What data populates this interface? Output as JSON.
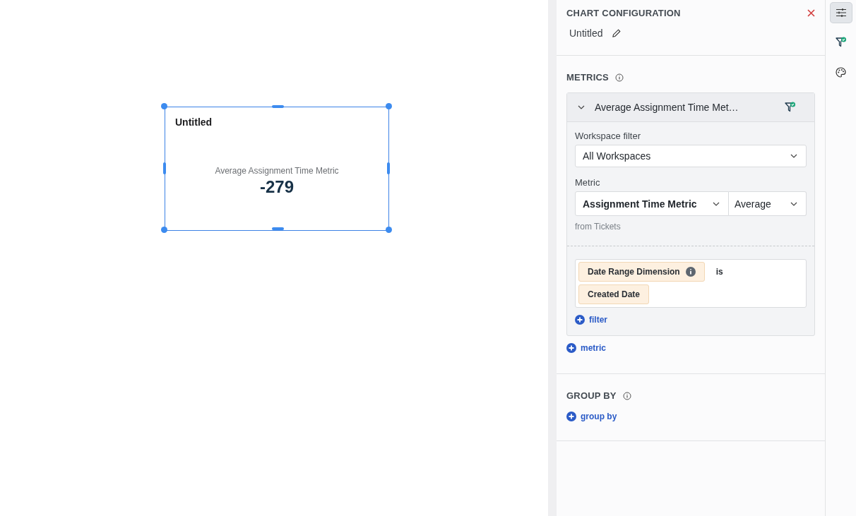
{
  "canvas": {
    "widget": {
      "title": "Untitled",
      "selected": true,
      "metric_label": "Average Assignment Time Metric",
      "value": "-279"
    }
  },
  "panel": {
    "title": "CHART CONFIGURATION",
    "chart_name": "Untitled",
    "metrics_heading": "METRICS",
    "metrics": [
      {
        "name": "Average Assignment Time Met…",
        "expanded": true,
        "workspace_filter_label": "Workspace filter",
        "workspace_filter": "All Workspaces",
        "metric_label": "Metric",
        "metric": "Assignment Time Metric",
        "aggregation": "Average",
        "source": "from Tickets",
        "filters": [
          {
            "dimension": "Date Range Dimension",
            "operator": "is",
            "value": "Created Date"
          }
        ],
        "add_filter": "filter"
      }
    ],
    "add_metric": "metric",
    "group_by_heading": "GROUP BY",
    "add_group_by": "group by"
  },
  "rail": [
    {
      "kind": "settings",
      "selected": true
    },
    {
      "kind": "filter",
      "selected": false
    },
    {
      "kind": "palette",
      "selected": false
    }
  ]
}
